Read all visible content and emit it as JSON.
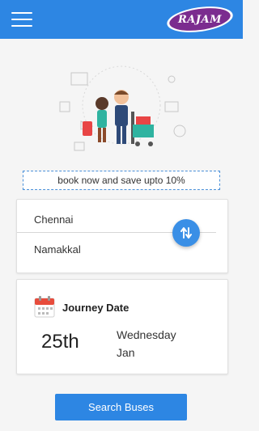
{
  "header": {
    "menu_icon": "hamburger-menu-icon",
    "logo_text": "RAJAM"
  },
  "promo": {
    "text": "book now and save upto 10%"
  },
  "route": {
    "from": "Chennai",
    "to": "Namakkal",
    "swap_icon": "swap-vertical-icon"
  },
  "journey": {
    "title": "Journey Date",
    "day": "25th",
    "weekday": "Wednesday",
    "month": "Jan",
    "icon": "calendar-icon"
  },
  "search": {
    "label": "Search Buses"
  },
  "colors": {
    "primary": "#2d86e3",
    "logo_bg": "#7b2c8f",
    "calendar_red": "#e74c3c"
  }
}
